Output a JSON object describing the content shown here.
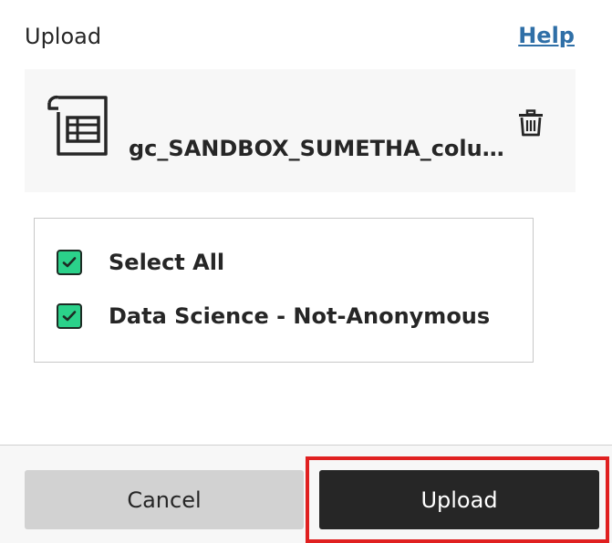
{
  "header": {
    "title": "Upload",
    "help_label": "Help"
  },
  "file": {
    "icon": "spreadsheet-file-icon",
    "name": "gc_SANDBOX_SUMETHA_column...",
    "delete_icon": "trash-icon"
  },
  "options": [
    {
      "label": "Select All",
      "checked": true
    },
    {
      "label": "Data Science - Not-Anonymous",
      "checked": true
    }
  ],
  "footer": {
    "cancel_label": "Cancel",
    "upload_label": "Upload"
  },
  "colors": {
    "checkbox": "#2bd18a",
    "primary_button": "#262626",
    "secondary_button": "#d2d2d2",
    "link": "#2f6fa7",
    "highlight": "#e02020"
  }
}
